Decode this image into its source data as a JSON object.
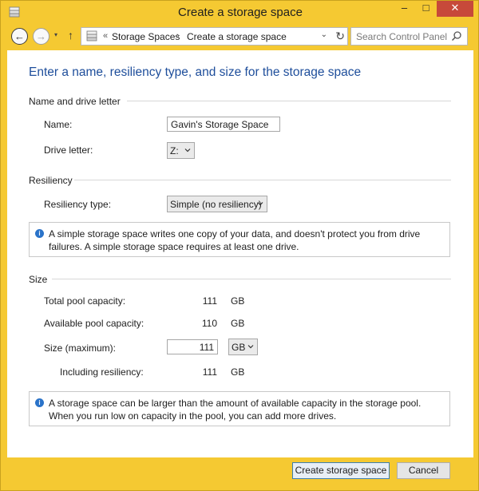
{
  "window": {
    "title": "Create a storage space"
  },
  "titlebar": {
    "min_glyph": "–",
    "max_glyph": "□",
    "close_glyph": "✕"
  },
  "nav": {
    "back_glyph": "←",
    "forward_glyph": "→",
    "recent_glyph": "▾",
    "up_glyph": "↑",
    "breadcrumb_sep": "«",
    "breadcrumb_arrow": "›",
    "breadcrumbs": [
      "Storage Spaces",
      "Create a storage space"
    ],
    "dropdown_glyph": "⌄",
    "refresh_glyph": "↻",
    "search_placeholder": "Search Control Panel"
  },
  "page": {
    "heading": "Enter a name, resiliency type, and size for the storage space"
  },
  "name_section": {
    "title": "Name and drive letter",
    "name_label": "Name:",
    "name_value": "Gavin's Storage Space",
    "drive_label": "Drive letter:",
    "drive_value": "Z:"
  },
  "resiliency_section": {
    "title": "Resiliency",
    "type_label": "Resiliency type:",
    "type_value": "Simple (no resiliency)",
    "info": "A simple storage space writes one copy of your data, and doesn't protect you from drive failures. A simple storage space requires at least one drive."
  },
  "size_section": {
    "title": "Size",
    "total_label": "Total pool capacity:",
    "total_value": "111",
    "total_unit": "GB",
    "available_label": "Available pool capacity:",
    "available_value": "110",
    "available_unit": "GB",
    "size_label": "Size (maximum):",
    "size_value": "111",
    "size_unit": "GB",
    "including_label": "Including resiliency:",
    "including_value": "111",
    "including_unit": "GB",
    "info": "A storage space can be larger than the amount of available capacity in the storage pool. When you run low on capacity in the pool, you can add more drives."
  },
  "buttons": {
    "create": "Create storage space",
    "cancel": "Cancel"
  },
  "colors": {
    "title_bar": "#f5c932",
    "heading": "#1e4e9b",
    "close": "#c7493a",
    "info_icon": "#2a73c9"
  }
}
